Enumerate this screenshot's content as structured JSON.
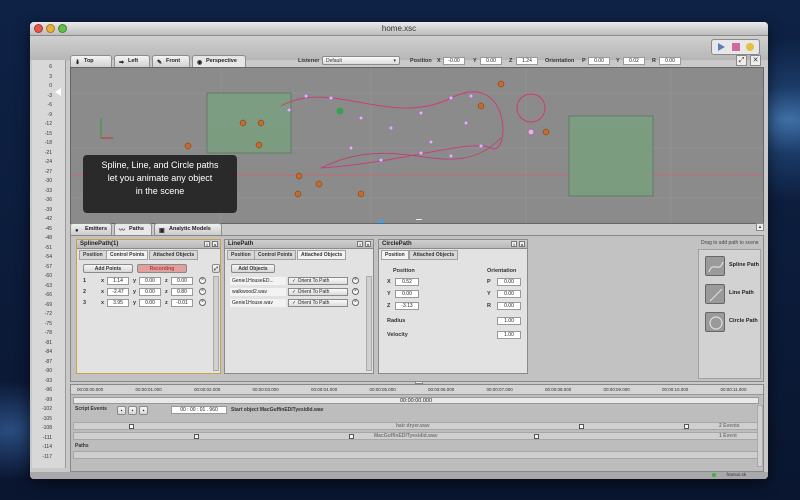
{
  "window": {
    "title": "home.xsc"
  },
  "ruler": {
    "ticks": [
      "6",
      "3",
      "0",
      "-3",
      "-6",
      "-9",
      "-12",
      "-15",
      "-18",
      "-21",
      "-24",
      "-27",
      "-30",
      "-33",
      "-36",
      "-39",
      "-42",
      "-45",
      "-48",
      "-51",
      "-54",
      "-57",
      "-60",
      "-63",
      "-66",
      "-69",
      "-72",
      "-75",
      "-78",
      "-81",
      "-84",
      "-87",
      "-90",
      "-93",
      "-96",
      "-99",
      "-102",
      "-105",
      "-108",
      "-111",
      "-114",
      "-117"
    ]
  },
  "view_tabs": [
    {
      "label": "Top",
      "icon": "arrow-down-icon"
    },
    {
      "label": "Left",
      "icon": "arrow-right-icon"
    },
    {
      "label": "Front",
      "icon": "pen-icon"
    },
    {
      "label": "Perspective",
      "icon": "eye-icon"
    }
  ],
  "listener": {
    "label": "Listener",
    "value": "Default"
  },
  "position": {
    "label": "Position",
    "x": "-0.00",
    "y": "0.00",
    "z": "1.24"
  },
  "orientation": {
    "label": "Orientation",
    "p": "0.00",
    "y": "0.02",
    "r": "0.00"
  },
  "tooltip": {
    "line1": "Spline, Line, and Circle paths",
    "line2": "let you animate any object",
    "line3": "in the scene"
  },
  "panel_tabs": [
    {
      "label": "Emitters",
      "icon": "dot-icon"
    },
    {
      "label": "Paths",
      "icon": "path-icon"
    },
    {
      "label": "Analytic Models",
      "icon": "cube-icon"
    }
  ],
  "spline": {
    "title": "SplinePath(1)",
    "tabs": [
      "Position",
      "Control Points",
      "Attached Objects"
    ],
    "add_points": "Add Points",
    "recording": "Recording",
    "points": [
      {
        "n": "1",
        "x": "1.14",
        "y": "0.00",
        "z": "0.00"
      },
      {
        "n": "2",
        "x": "-2.47",
        "y": "0.00",
        "z": "0.80"
      },
      {
        "n": "3",
        "x": "3.95",
        "y": "0.00",
        "z": "-0.01"
      }
    ]
  },
  "line": {
    "title": "LinePath",
    "tabs": [
      "Position",
      "Control Points",
      "Attached Objects"
    ],
    "add_objects": "Add Objects",
    "objects": [
      {
        "name": "Genie1HouseED...",
        "orient": "✓ Orient To Path"
      },
      {
        "name": "walkwood2.wav",
        "orient": "✓ Orient To Path"
      },
      {
        "name": "Genie1House.wav",
        "orient": "✓ Orient To Path"
      }
    ]
  },
  "circle": {
    "title": "CirclePath",
    "tabs": [
      "Position",
      "Attached Objects"
    ],
    "position_label": "Position",
    "orientation_label": "Orientation",
    "x": "0.52",
    "y": "0.00",
    "z": "-3.13",
    "p": "0.00",
    "yo": "0.00",
    "r": "0.00",
    "radius_label": "Radius",
    "radius": "1.00",
    "velocity_label": "Velocity",
    "velocity": "1.00"
  },
  "dropzone": {
    "hint": "Drag to add path to scene",
    "items": [
      {
        "label": "Spline Path"
      },
      {
        "label": "Line Path"
      },
      {
        "label": "Circle Path"
      }
    ]
  },
  "timeline": {
    "marks": [
      "00:00:00.000",
      "00:00:01.000",
      "00:00:02.000",
      "00:00:03.000",
      "00:00:04.000",
      "00:00:05.000",
      "00:00:06.000",
      "00:00:07.000",
      "00:00:08.000",
      "00:00:09.000",
      "00:00:10.000",
      "00:00:11.000"
    ],
    "current": "00:00:00.000",
    "script_events": "Script Events",
    "time_field": "00 : 00 : 01 . 960",
    "start_object": "Start object MacGuffinEDITyesidid.wav",
    "track1": "hair dryer.wav",
    "track1_events": "2 Events",
    "track2": "MacGuffinEDITyesidid.wav",
    "track2_events": "1 Event",
    "paths": "Paths"
  },
  "status": {
    "brand": "framus.sk"
  },
  "colors": {
    "accent": "#c8a24a",
    "recording": "#e0a0a0",
    "spline": "#d14070",
    "path_node": "#c8a0e0"
  }
}
